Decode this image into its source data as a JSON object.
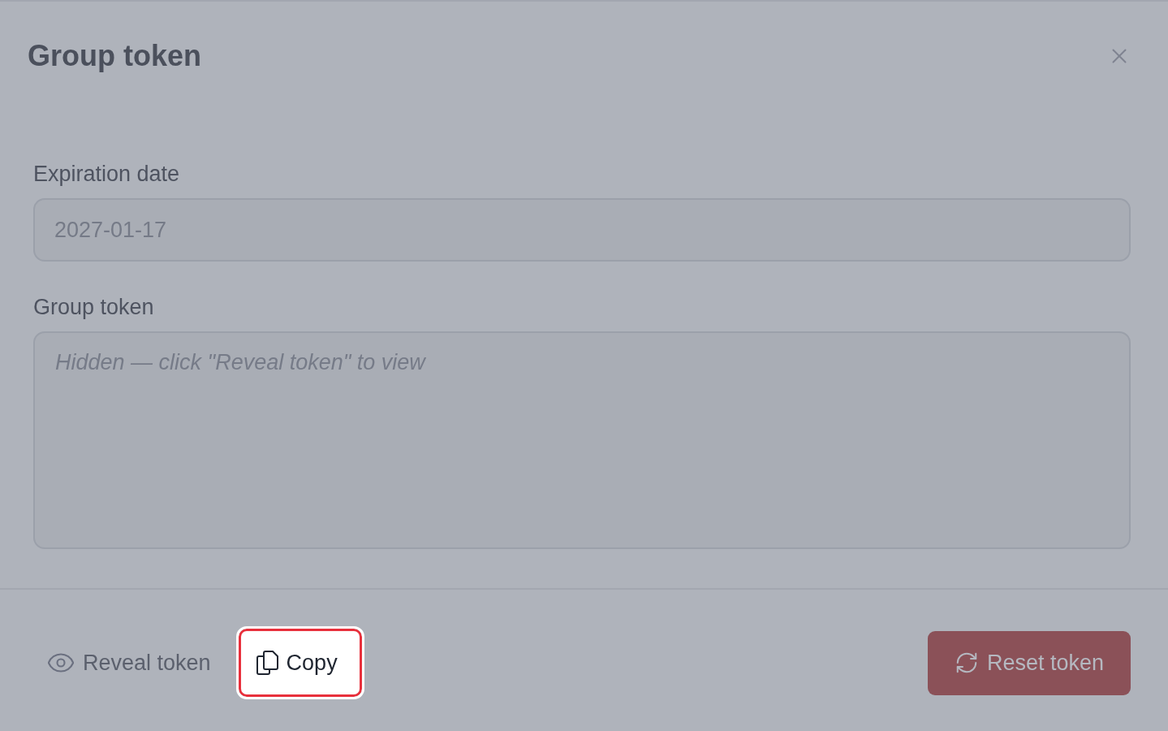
{
  "dialog": {
    "title": "Group token"
  },
  "fields": [
    {
      "kind": "input",
      "label": "Expiration date",
      "value": "2027-01-17",
      "disabled": true
    },
    {
      "kind": "textarea",
      "label": "Group token",
      "placeholder": "Hidden — click \"Reveal token\" to view"
    }
  ],
  "footer": {
    "reveal_button": {
      "label": "Reveal token"
    },
    "copy_button": {
      "label": "Copy",
      "highlighted": true
    },
    "reset_button": {
      "label": "Reset token"
    }
  }
}
